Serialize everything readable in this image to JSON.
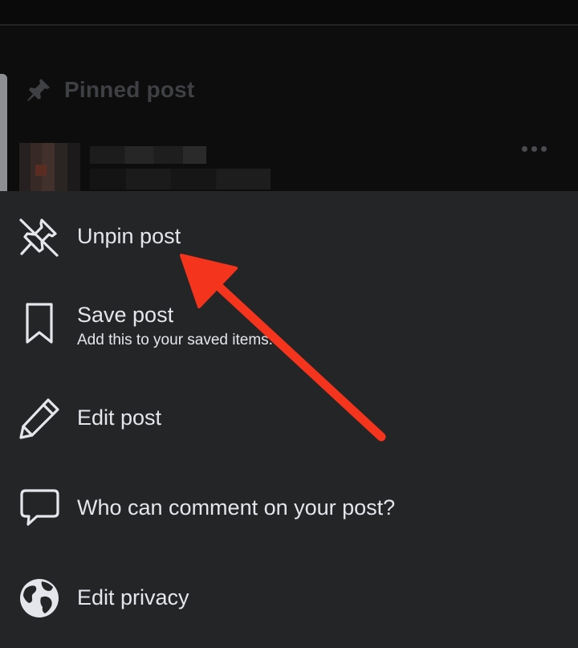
{
  "background": {
    "pinned_label": "Pinned post",
    "more_icon": "more-horizontal-icon"
  },
  "menu": {
    "items": [
      {
        "title": "Unpin post",
        "icon": "unpin-icon"
      },
      {
        "title": "Save post",
        "subtitle": "Add this to your saved items.",
        "icon": "bookmark-icon"
      },
      {
        "title": "Edit post",
        "icon": "pencil-icon"
      },
      {
        "title": "Who can comment on your post?",
        "icon": "comment-bubble-icon"
      },
      {
        "title": "Edit privacy",
        "icon": "globe-icon"
      }
    ]
  },
  "colors": {
    "sheet_background": "#242527",
    "text": "#e4e6eb",
    "annotation_arrow": "#f4341c"
  }
}
